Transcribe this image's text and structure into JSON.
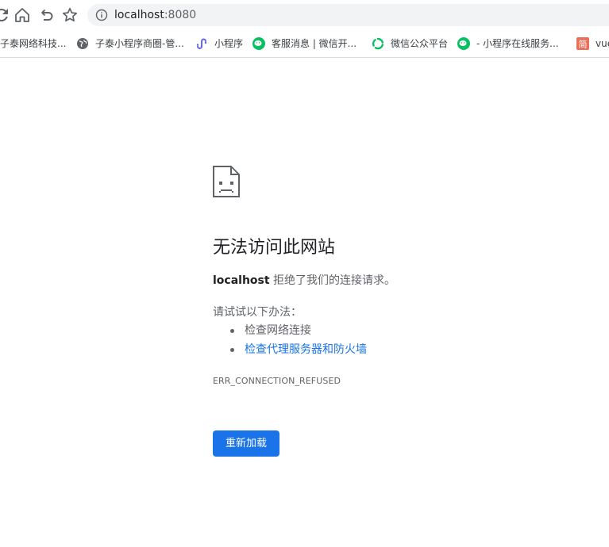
{
  "toolbar": {
    "url_host": "localhost",
    "url_port": ":8080"
  },
  "bookmarks": [
    {
      "icon": "zitai-icon",
      "label": "子泰网络科技..."
    },
    {
      "icon": "globe-icon",
      "label": "子泰小程序商圈-管..."
    },
    {
      "icon": "miniprogram-icon",
      "label": "小程序"
    },
    {
      "icon": "wechat-icon",
      "label": "客服消息 | 微信开..."
    },
    {
      "icon": "wechat-mp-icon",
      "label": "微信公众平台"
    },
    {
      "icon": "wechat-icon",
      "label": "- 小程序在线服务..."
    },
    {
      "icon": "jianshu-icon",
      "label": "vue"
    }
  ],
  "error": {
    "title": "无法访问此网站",
    "host": "localhost",
    "summary_suffix": " 拒绝了我们的连接请求。",
    "try_label": "请试试以下办法：",
    "suggestions": [
      "检查网络连接",
      "检查代理服务器和防火墙"
    ],
    "code": "ERR_CONNECTION_REFUSED",
    "reload_label": "重新加载"
  },
  "colors": {
    "accent": "#1a73e8",
    "wechat_green": "#07c160",
    "jianshu_red": "#ea6f5a"
  }
}
